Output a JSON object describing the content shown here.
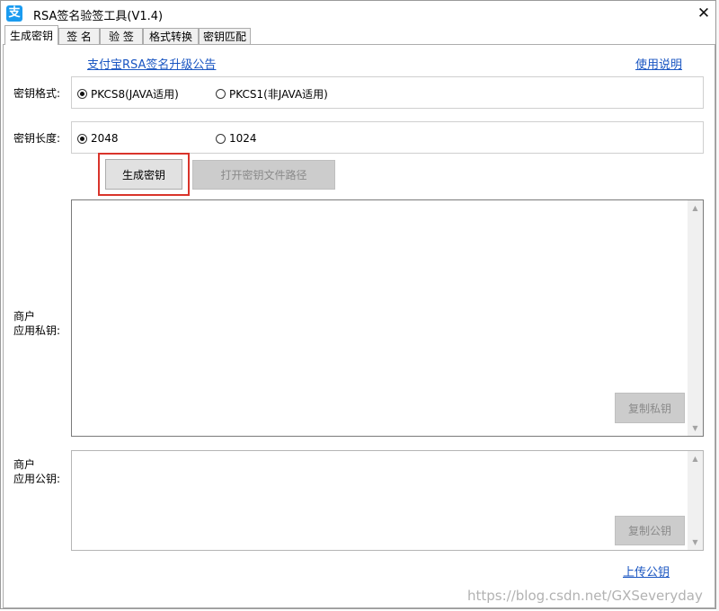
{
  "window": {
    "title": "RSA签名验签工具(V1.4)",
    "close_glyph": "✕",
    "app_icon_glyph": "支"
  },
  "tabs": [
    {
      "label": "生成密钥",
      "active": true
    },
    {
      "label": "签 名",
      "active": false
    },
    {
      "label": "验 签",
      "active": false
    },
    {
      "label": "格式转换",
      "active": false
    },
    {
      "label": "密钥匹配",
      "active": false
    }
  ],
  "links": {
    "announcement": "支付宝RSA签名升级公告",
    "usage": "使用说明",
    "upload_public_key": "上传公钥"
  },
  "key_format": {
    "label": "密钥格式:",
    "options": [
      {
        "label": "PKCS8(JAVA适用)",
        "checked": true
      },
      {
        "label": "PKCS1(非JAVA适用)",
        "checked": false
      }
    ]
  },
  "key_length": {
    "label": "密钥长度:",
    "options": [
      {
        "label": "2048",
        "checked": true
      },
      {
        "label": "1024",
        "checked": false
      }
    ]
  },
  "buttons": {
    "generate": "生成密钥",
    "open_path": "打开密钥文件路径",
    "copy_private": "复制私钥",
    "copy_public": "复制公钥"
  },
  "private_key": {
    "label_line1": "商户",
    "label_line2": "应用私钥:",
    "value": ""
  },
  "public_key": {
    "label_line1": "商户",
    "label_line2": "应用公钥:",
    "value": ""
  },
  "icons": {
    "scroll_up": "▲",
    "scroll_down": "▼"
  },
  "watermark": "https://blog.csdn.net/GXSeveryday",
  "colors": {
    "highlight": "#d9342b",
    "link": "#1a56c2",
    "app_icon": "#1a9bf0"
  }
}
